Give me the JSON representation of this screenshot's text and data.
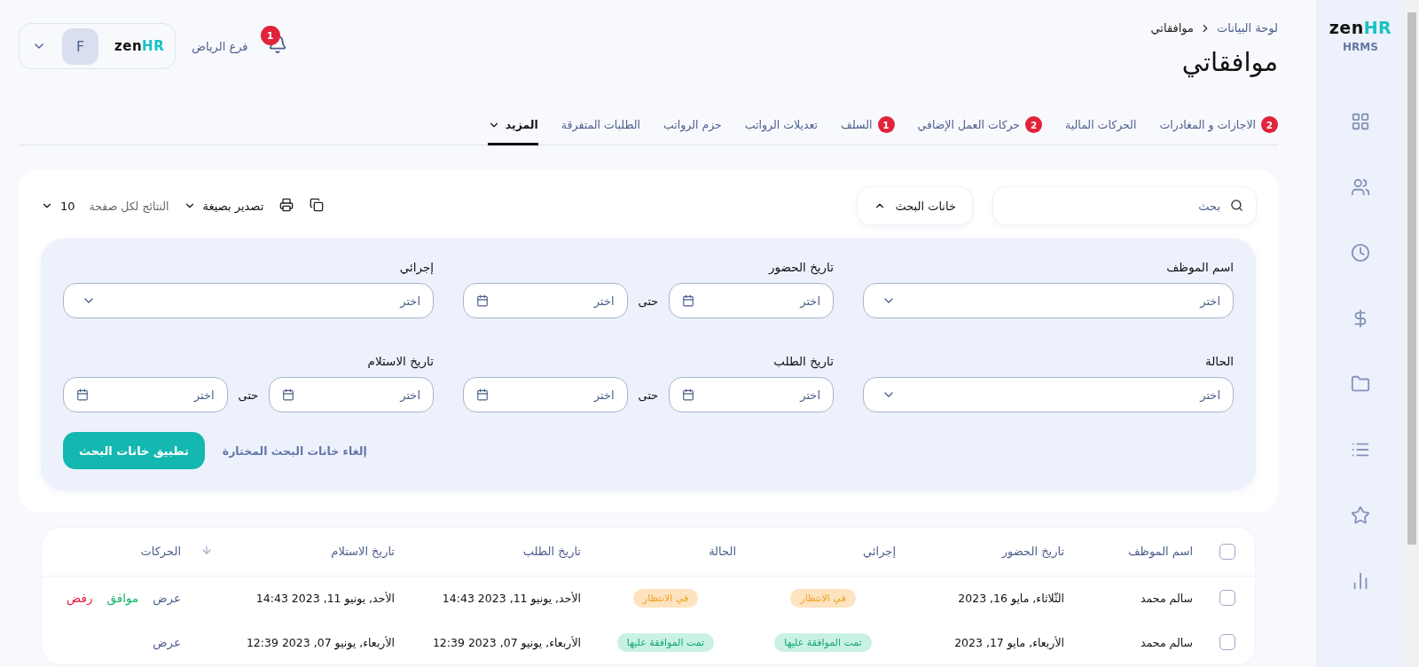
{
  "sidebar": {
    "logo": {
      "brand": "zen",
      "accent": "HR"
    },
    "subtitle": "HRMS"
  },
  "header": {
    "breadcrumb": [
      "لوحة البيانات",
      "موافقاتي"
    ],
    "title": "موافقاتي",
    "notifications": {
      "count": "1"
    },
    "branch": "فرع الرياض",
    "account": {
      "logo": {
        "brand": "zen",
        "accent": "HR"
      },
      "avatar": "F"
    }
  },
  "tabs": [
    {
      "label": "الاجازات و المغادرات",
      "badge": "2",
      "selected": false
    },
    {
      "label": "الحركات المالية",
      "selected": false
    },
    {
      "label": "حركات العمل الإضافي",
      "badge": "2",
      "selected": false
    },
    {
      "label": "السلف",
      "badge": "1",
      "selected": false
    },
    {
      "label": "تعديلات الرواتب",
      "selected": false
    },
    {
      "label": "حزم الرواتب",
      "selected": false
    },
    {
      "label": "الطلبات المتفرقة",
      "selected": false
    },
    {
      "label": "المزيد",
      "kind": "dropdown",
      "selected": true
    }
  ],
  "toolbar": {
    "search": {
      "placeholder": "بحث"
    },
    "filters_button": {
      "label": "خانات البحث",
      "expanded": true
    },
    "export": {
      "label": "تصدير بصيغة"
    },
    "per_page": {
      "label": "النتائج لكل صفحة",
      "value": "10"
    }
  },
  "filters": {
    "fields": [
      {
        "label": "اسم الموظف",
        "kind": "select",
        "placeholder": "اختر"
      },
      {
        "label": "تاريخ الحضور",
        "kind": "date_range",
        "from": "اختر",
        "separator": "حتى",
        "to": "اختر"
      },
      {
        "label": "إجرائي",
        "kind": "select",
        "placeholder": "اختر"
      },
      {
        "label": "الحالة",
        "kind": "select",
        "placeholder": "اختر"
      },
      {
        "label": "تاريخ الطلب",
        "kind": "date_range",
        "from": "اختر",
        "separator": "حتى",
        "to": "اختر"
      },
      {
        "label": "تاريخ الاستلام",
        "kind": "date_range",
        "from": "اختر",
        "separator": "حتى",
        "to": "اختر"
      }
    ],
    "apply": "تطبيق خانات البحث",
    "clear": "إلغاء خانات البحث المختارة"
  },
  "table": {
    "select_all": {
      "checked": false
    },
    "columns": [
      "اسم الموظف",
      "تاريخ الحضور",
      "إجرائي",
      "الحالة",
      "تاريخ الطلب",
      "تاريخ الاستلام",
      "الحركات"
    ],
    "rows": [
      {
        "checked": false,
        "employee": "سالم محمد",
        "attendance": "الثّلاثاء, مايو 16, 2023",
        "procedure": {
          "label": "في الانتظار",
          "kind": "pending"
        },
        "status": {
          "label": "في الانتظار",
          "kind": "pending"
        },
        "requested": "الأحد, يونيو 11, 2023 14:43",
        "received": "الأحد, يونيو 11, 2023 14:43",
        "actions": [
          {
            "label": "عرض",
            "kind": "view"
          },
          {
            "label": "موافق",
            "kind": "approve"
          },
          {
            "label": "رفض",
            "kind": "reject"
          }
        ]
      },
      {
        "checked": false,
        "employee": "سالم محمد",
        "attendance": "الأربعاء, مايو 17, 2023",
        "procedure": {
          "label": "تمت الموافقة عليها",
          "kind": "approved"
        },
        "status": {
          "label": "تمت الموافقة عليها",
          "kind": "approved"
        },
        "requested": "الأربعاء, يونيو 07, 2023 12:39",
        "received": "الأربعاء, يونيو 07, 2023 12:39",
        "actions": [
          {
            "label": "عرض",
            "kind": "view"
          }
        ]
      }
    ]
  }
}
